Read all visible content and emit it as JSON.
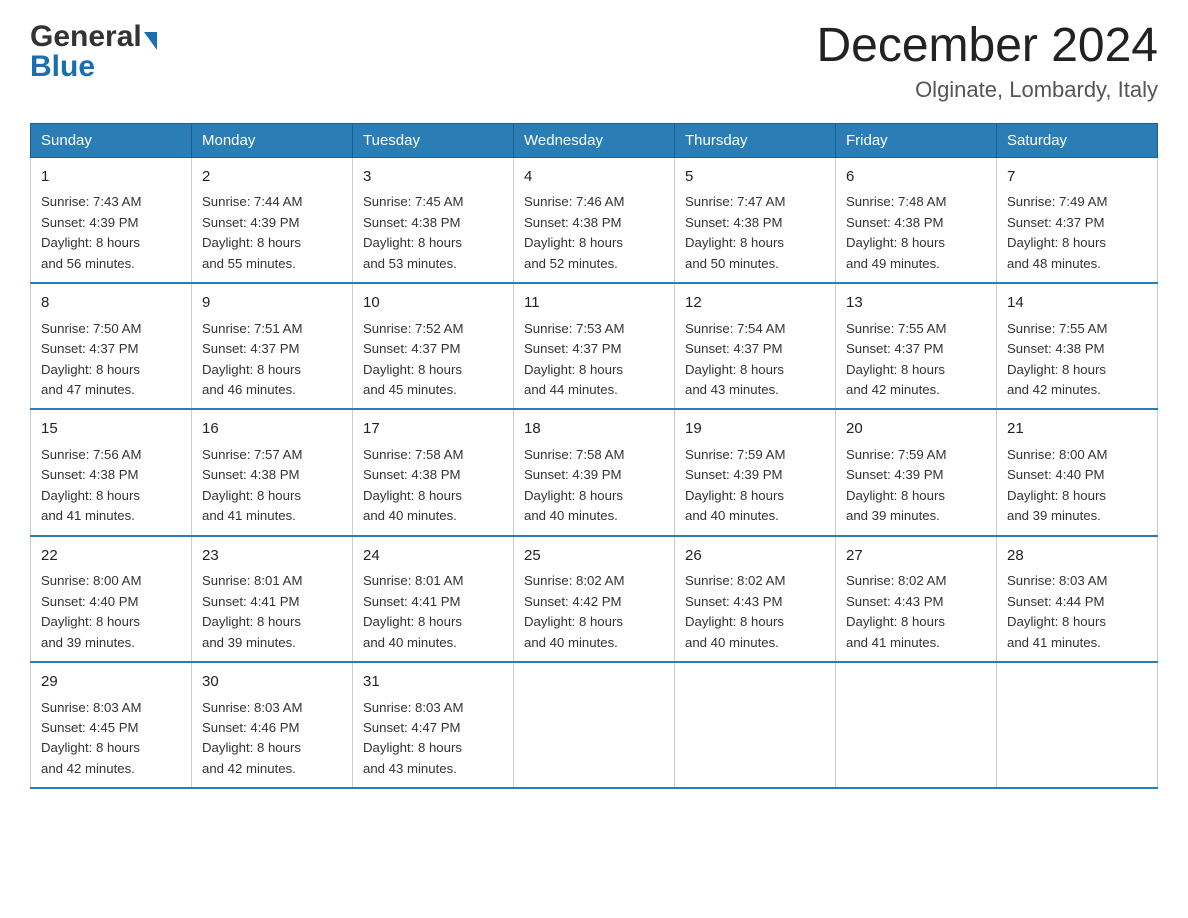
{
  "header": {
    "logo_general": "General",
    "logo_blue": "Blue",
    "month_title": "December 2024",
    "location": "Olginate, Lombardy, Italy"
  },
  "weekdays": [
    "Sunday",
    "Monday",
    "Tuesday",
    "Wednesday",
    "Thursday",
    "Friday",
    "Saturday"
  ],
  "weeks": [
    [
      {
        "day": "1",
        "sunrise": "7:43 AM",
        "sunset": "4:39 PM",
        "daylight": "8 hours and 56 minutes."
      },
      {
        "day": "2",
        "sunrise": "7:44 AM",
        "sunset": "4:39 PM",
        "daylight": "8 hours and 55 minutes."
      },
      {
        "day": "3",
        "sunrise": "7:45 AM",
        "sunset": "4:38 PM",
        "daylight": "8 hours and 53 minutes."
      },
      {
        "day": "4",
        "sunrise": "7:46 AM",
        "sunset": "4:38 PM",
        "daylight": "8 hours and 52 minutes."
      },
      {
        "day": "5",
        "sunrise": "7:47 AM",
        "sunset": "4:38 PM",
        "daylight": "8 hours and 50 minutes."
      },
      {
        "day": "6",
        "sunrise": "7:48 AM",
        "sunset": "4:38 PM",
        "daylight": "8 hours and 49 minutes."
      },
      {
        "day": "7",
        "sunrise": "7:49 AM",
        "sunset": "4:37 PM",
        "daylight": "8 hours and 48 minutes."
      }
    ],
    [
      {
        "day": "8",
        "sunrise": "7:50 AM",
        "sunset": "4:37 PM",
        "daylight": "8 hours and 47 minutes."
      },
      {
        "day": "9",
        "sunrise": "7:51 AM",
        "sunset": "4:37 PM",
        "daylight": "8 hours and 46 minutes."
      },
      {
        "day": "10",
        "sunrise": "7:52 AM",
        "sunset": "4:37 PM",
        "daylight": "8 hours and 45 minutes."
      },
      {
        "day": "11",
        "sunrise": "7:53 AM",
        "sunset": "4:37 PM",
        "daylight": "8 hours and 44 minutes."
      },
      {
        "day": "12",
        "sunrise": "7:54 AM",
        "sunset": "4:37 PM",
        "daylight": "8 hours and 43 minutes."
      },
      {
        "day": "13",
        "sunrise": "7:55 AM",
        "sunset": "4:37 PM",
        "daylight": "8 hours and 42 minutes."
      },
      {
        "day": "14",
        "sunrise": "7:55 AM",
        "sunset": "4:38 PM",
        "daylight": "8 hours and 42 minutes."
      }
    ],
    [
      {
        "day": "15",
        "sunrise": "7:56 AM",
        "sunset": "4:38 PM",
        "daylight": "8 hours and 41 minutes."
      },
      {
        "day": "16",
        "sunrise": "7:57 AM",
        "sunset": "4:38 PM",
        "daylight": "8 hours and 41 minutes."
      },
      {
        "day": "17",
        "sunrise": "7:58 AM",
        "sunset": "4:38 PM",
        "daylight": "8 hours and 40 minutes."
      },
      {
        "day": "18",
        "sunrise": "7:58 AM",
        "sunset": "4:39 PM",
        "daylight": "8 hours and 40 minutes."
      },
      {
        "day": "19",
        "sunrise": "7:59 AM",
        "sunset": "4:39 PM",
        "daylight": "8 hours and 40 minutes."
      },
      {
        "day": "20",
        "sunrise": "7:59 AM",
        "sunset": "4:39 PM",
        "daylight": "8 hours and 39 minutes."
      },
      {
        "day": "21",
        "sunrise": "8:00 AM",
        "sunset": "4:40 PM",
        "daylight": "8 hours and 39 minutes."
      }
    ],
    [
      {
        "day": "22",
        "sunrise": "8:00 AM",
        "sunset": "4:40 PM",
        "daylight": "8 hours and 39 minutes."
      },
      {
        "day": "23",
        "sunrise": "8:01 AM",
        "sunset": "4:41 PM",
        "daylight": "8 hours and 39 minutes."
      },
      {
        "day": "24",
        "sunrise": "8:01 AM",
        "sunset": "4:41 PM",
        "daylight": "8 hours and 40 minutes."
      },
      {
        "day": "25",
        "sunrise": "8:02 AM",
        "sunset": "4:42 PM",
        "daylight": "8 hours and 40 minutes."
      },
      {
        "day": "26",
        "sunrise": "8:02 AM",
        "sunset": "4:43 PM",
        "daylight": "8 hours and 40 minutes."
      },
      {
        "day": "27",
        "sunrise": "8:02 AM",
        "sunset": "4:43 PM",
        "daylight": "8 hours and 41 minutes."
      },
      {
        "day": "28",
        "sunrise": "8:03 AM",
        "sunset": "4:44 PM",
        "daylight": "8 hours and 41 minutes."
      }
    ],
    [
      {
        "day": "29",
        "sunrise": "8:03 AM",
        "sunset": "4:45 PM",
        "daylight": "8 hours and 42 minutes."
      },
      {
        "day": "30",
        "sunrise": "8:03 AM",
        "sunset": "4:46 PM",
        "daylight": "8 hours and 42 minutes."
      },
      {
        "day": "31",
        "sunrise": "8:03 AM",
        "sunset": "4:47 PM",
        "daylight": "8 hours and 43 minutes."
      },
      null,
      null,
      null,
      null
    ]
  ],
  "labels": {
    "sunrise": "Sunrise:",
    "sunset": "Sunset:",
    "daylight": "Daylight:"
  }
}
